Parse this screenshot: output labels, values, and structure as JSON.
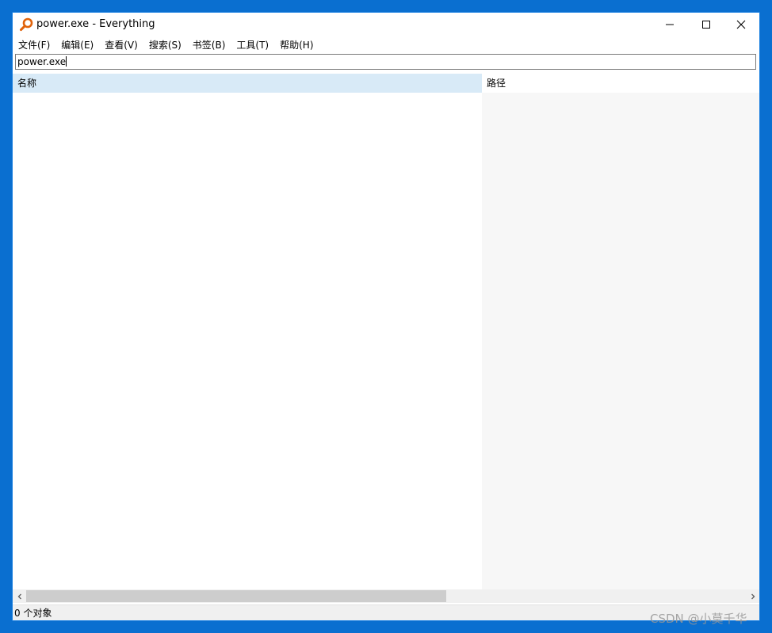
{
  "window": {
    "title": "power.exe - Everything",
    "icon": "magnifier-icon",
    "accent_color": "#0a6fd0"
  },
  "menu": {
    "items": [
      "文件(F)",
      "编辑(E)",
      "查看(V)",
      "搜索(S)",
      "书签(B)",
      "工具(T)",
      "帮助(H)"
    ]
  },
  "search": {
    "value": "power.exe"
  },
  "columns": {
    "name": "名称",
    "path": "路径"
  },
  "status": {
    "text": "0 个对象"
  },
  "watermark": {
    "text": "CSDN @小莫千华"
  }
}
